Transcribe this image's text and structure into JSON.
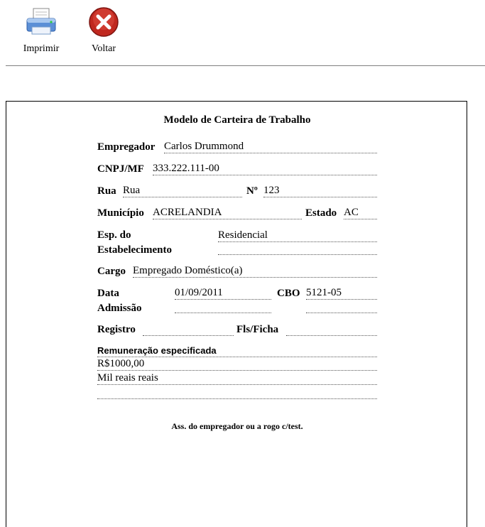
{
  "toolbar": {
    "print_label": "Imprimir",
    "back_label": "Voltar"
  },
  "doc": {
    "title": "Modelo de Carteira de Trabalho",
    "empregador_label": "Empregador",
    "empregador_value": "Carlos Drummond",
    "cnpj_label": "CNPJ/MF",
    "cnpj_value": "333.222.111-00",
    "rua_label": "Rua",
    "rua_value": "Rua",
    "numero_label": "Nº",
    "numero_value": "123",
    "municipio_label": "Município",
    "municipio_value": "ACRELANDIA",
    "estado_label": "Estado",
    "estado_value": "AC",
    "esp_label_1": "Esp. do",
    "esp_label_2": "Estabelecimento",
    "esp_value": "Residencial",
    "cargo_label": "Cargo",
    "cargo_value": "Empregado Doméstico(a)",
    "data_label_1": "Data",
    "data_label_2": "Admissão",
    "data_value": "01/09/2011",
    "cbo_label": "CBO",
    "cbo_value": "5121-05",
    "registro_label": "Registro",
    "registro_value": "",
    "fls_label": "Fls/Ficha",
    "fls_value": "",
    "remuneracao_label": "Remuneração especificada",
    "remuneracao_value": "R$1000,00",
    "remuneracao_extenso": "Mil reais reais",
    "remuneracao_extra": "",
    "signature_label": "Ass. do empregador ou a rogo c/test."
  }
}
